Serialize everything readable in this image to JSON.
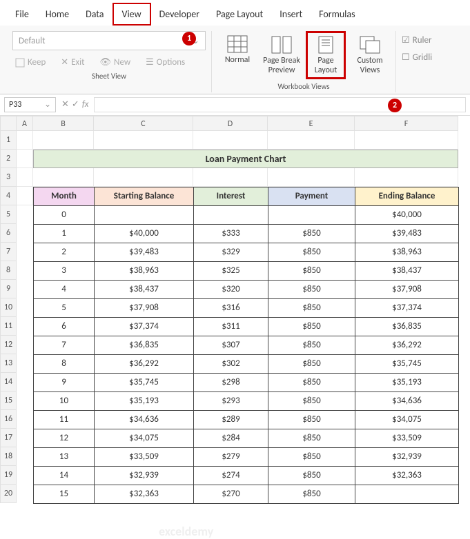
{
  "tabs": {
    "file": "File",
    "home": "Home",
    "data": "Data",
    "view": "View",
    "developer": "Developer",
    "page_layout": "Page Layout",
    "insert": "Insert",
    "formulas": "Formulas"
  },
  "sheetview": {
    "dropdown": "Default",
    "keep": "Keep",
    "exit": "Exit",
    "new": "New",
    "options": "Options",
    "label": "Sheet View"
  },
  "workbook_views": {
    "normal": "Normal",
    "page_break": "Page Break Preview",
    "page_layout": "Page Layout",
    "custom": "Custom Views",
    "label": "Workbook Views"
  },
  "show_group": {
    "ruler": "Ruler",
    "gridlines": "Gridli"
  },
  "callouts": {
    "c1": "1",
    "c2": "2"
  },
  "namebox": "P33",
  "fx": "fx",
  "columns": [
    "A",
    "B",
    "C",
    "D",
    "E",
    "F"
  ],
  "rows": [
    "1",
    "2",
    "3",
    "4",
    "5",
    "6",
    "7",
    "8",
    "9",
    "10",
    "11",
    "12",
    "13",
    "14",
    "15",
    "16",
    "17",
    "18",
    "19",
    "20"
  ],
  "title": "Loan Payment Chart",
  "headers": {
    "month": "Month",
    "start": "Starting Balance",
    "interest": "Interest",
    "payment": "Payment",
    "end": "Ending Balance"
  },
  "data": [
    {
      "m": "0",
      "s": "",
      "i": "",
      "p": "",
      "e": "$40,000"
    },
    {
      "m": "1",
      "s": "$40,000",
      "i": "$333",
      "p": "$850",
      "e": "$39,483"
    },
    {
      "m": "2",
      "s": "$39,483",
      "i": "$329",
      "p": "$850",
      "e": "$38,963"
    },
    {
      "m": "3",
      "s": "$38,963",
      "i": "$325",
      "p": "$850",
      "e": "$38,437"
    },
    {
      "m": "4",
      "s": "$38,437",
      "i": "$320",
      "p": "$850",
      "e": "$37,908"
    },
    {
      "m": "5",
      "s": "$37,908",
      "i": "$316",
      "p": "$850",
      "e": "$37,374"
    },
    {
      "m": "6",
      "s": "$37,374",
      "i": "$311",
      "p": "$850",
      "e": "$36,835"
    },
    {
      "m": "7",
      "s": "$36,835",
      "i": "$307",
      "p": "$850",
      "e": "$36,292"
    },
    {
      "m": "8",
      "s": "$36,292",
      "i": "$302",
      "p": "$850",
      "e": "$35,745"
    },
    {
      "m": "9",
      "s": "$35,745",
      "i": "$298",
      "p": "$850",
      "e": "$35,193"
    },
    {
      "m": "10",
      "s": "$35,193",
      "i": "$293",
      "p": "$850",
      "e": "$34,636"
    },
    {
      "m": "11",
      "s": "$34,636",
      "i": "$289",
      "p": "$850",
      "e": "$34,075"
    },
    {
      "m": "12",
      "s": "$34,075",
      "i": "$284",
      "p": "$850",
      "e": "$33,509"
    },
    {
      "m": "13",
      "s": "$33,509",
      "i": "$279",
      "p": "$850",
      "e": "$32,939"
    },
    {
      "m": "14",
      "s": "$32,939",
      "i": "$274",
      "p": "$850",
      "e": "$32,363"
    },
    {
      "m": "15",
      "s": "$32,363",
      "i": "$270",
      "p": "$850",
      "e": ""
    }
  ],
  "watermark": "exceldemy"
}
